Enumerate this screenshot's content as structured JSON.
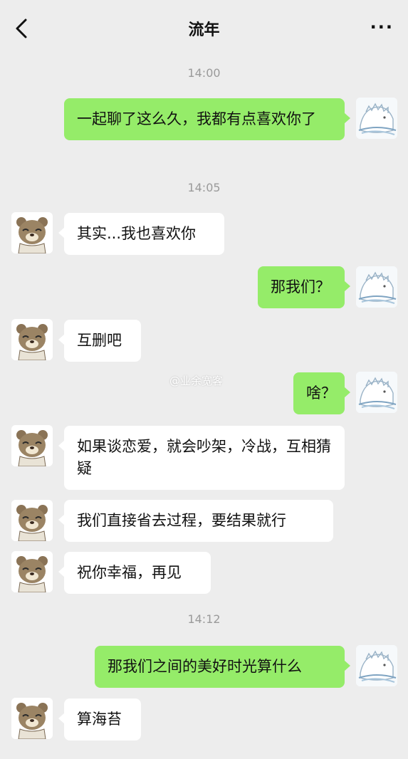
{
  "header": {
    "title": "流年",
    "back_icon": "chevron-left-icon",
    "more_label": "···"
  },
  "times": [
    "14:00",
    "14:05",
    "14:12"
  ],
  "messages": [
    {
      "from": "me",
      "text": "一起聊了这么久，我都有点喜欢你了"
    },
    {
      "from": "them",
      "text": "其实...我也喜欢你"
    },
    {
      "from": "me",
      "text": "那我们？"
    },
    {
      "from": "them",
      "text": "互删吧"
    },
    {
      "from": "me",
      "text": "啥？"
    },
    {
      "from": "them",
      "text": "如果谈恋爱，就会吵架，冷战，互相猜疑"
    },
    {
      "from": "them",
      "text": "我们直接省去过程，要结果就行"
    },
    {
      "from": "them",
      "text": "祝你幸福，再见"
    },
    {
      "from": "me",
      "text": "那我们之间的美好时光算什么"
    },
    {
      "from": "them",
      "text": "算海苔"
    }
  ],
  "watermark": "@业余宽客",
  "colors": {
    "background": "#ededed",
    "outgoing_bubble": "#95ec69",
    "incoming_bubble": "#ffffff",
    "timestamp": "#9a9a9a"
  }
}
